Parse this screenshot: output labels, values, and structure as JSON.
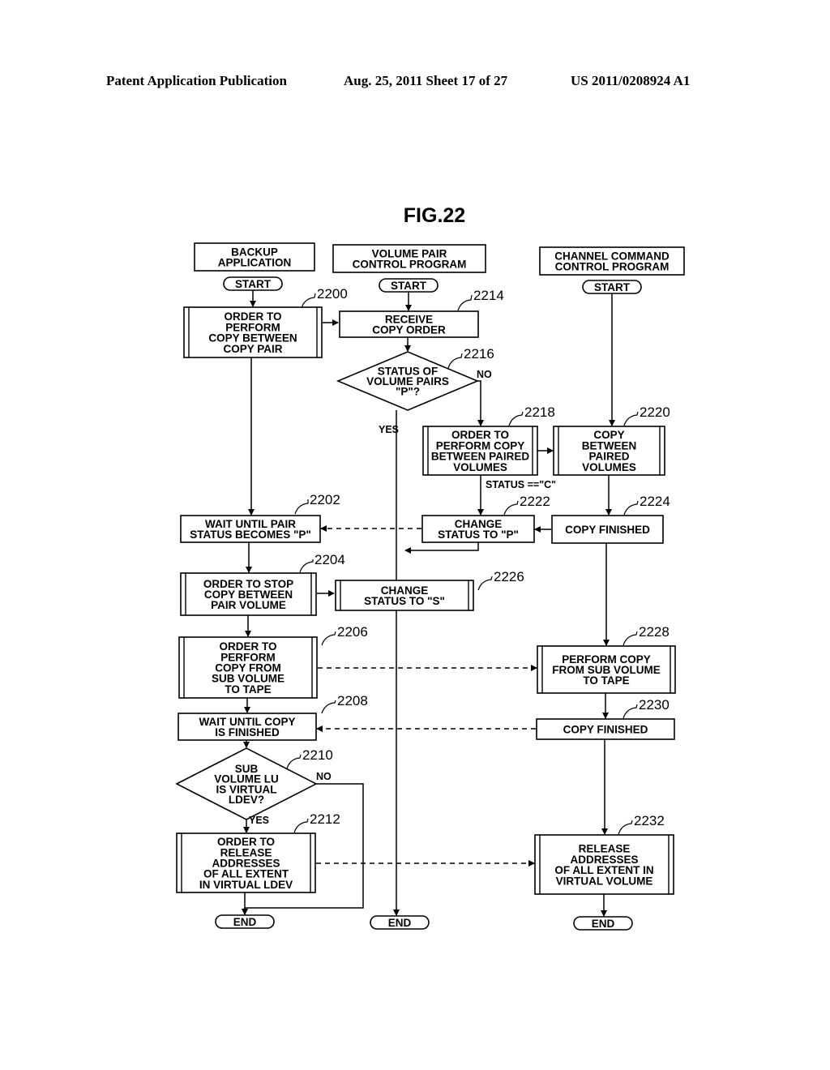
{
  "header": {
    "publication": "Patent Application Publication",
    "date_sheet": "Aug. 25, 2011  Sheet 17 of 27",
    "number": "US 2011/0208924 A1"
  },
  "figure": {
    "title": "FIG.22",
    "columns": [
      {
        "id": "backup",
        "title": [
          "BACKUP",
          "APPLICATION"
        ]
      },
      {
        "id": "vpcp",
        "title": [
          "VOLUME PAIR",
          "CONTROL PROGRAM"
        ]
      },
      {
        "id": "cccp",
        "title": [
          "CHANNEL COMMAND",
          "CONTROL PROGRAM"
        ]
      }
    ],
    "terminals": {
      "start": "START",
      "end": "END"
    },
    "steps": [
      {
        "ref": "2200",
        "type": "subroutine",
        "lines": [
          "ORDER TO",
          "PERFORM",
          "COPY BETWEEN",
          "COPY PAIR"
        ]
      },
      {
        "ref": "2214",
        "type": "process",
        "lines": [
          "RECEIVE",
          "COPY ORDER"
        ]
      },
      {
        "ref": "2216",
        "type": "decision",
        "lines": [
          "STATUS OF",
          "VOLUME PAIRS",
          "\"P\"?"
        ],
        "yes": "YES",
        "no": "NO"
      },
      {
        "ref": "2218",
        "type": "subroutine",
        "lines": [
          "ORDER TO",
          "PERFORM COPY",
          "BETWEEN PAIRED",
          "VOLUMES"
        ]
      },
      {
        "ref": "2220",
        "type": "subroutine",
        "lines": [
          "COPY",
          "BETWEEN",
          "PAIRED",
          "VOLUMES"
        ]
      },
      {
        "ref": "2202",
        "type": "process",
        "lines": [
          "WAIT UNTIL PAIR",
          "STATUS BECOMES \"P\""
        ]
      },
      {
        "ref": "2222",
        "type": "process",
        "lines": [
          "CHANGE",
          "STATUS TO \"P\""
        ]
      },
      {
        "ref": "2224",
        "type": "process",
        "lines": [
          "COPY FINISHED"
        ]
      },
      {
        "ref": "2204",
        "type": "subroutine",
        "lines": [
          "ORDER TO STOP",
          "COPY BETWEEN",
          "PAIR VOLUME"
        ]
      },
      {
        "ref": "2226",
        "type": "subroutine",
        "lines": [
          "CHANGE",
          "STATUS TO \"S\""
        ]
      },
      {
        "ref": "2206",
        "type": "subroutine",
        "lines": [
          "ORDER TO",
          "PERFORM",
          "COPY FROM",
          "SUB VOLUME",
          "TO TAPE"
        ]
      },
      {
        "ref": "2228",
        "type": "subroutine",
        "lines": [
          "PERFORM COPY",
          "FROM SUB VOLUME",
          "TO TAPE"
        ]
      },
      {
        "ref": "2208",
        "type": "process",
        "lines": [
          "WAIT UNTIL COPY",
          "IS FINISHED"
        ]
      },
      {
        "ref": "2230",
        "type": "process",
        "lines": [
          "COPY FINISHED"
        ]
      },
      {
        "ref": "2210",
        "type": "decision",
        "lines": [
          "SUB",
          "VOLUME LU",
          "IS VIRTUAL",
          "LDEV?"
        ],
        "yes": "YES",
        "no": "NO"
      },
      {
        "ref": "2212",
        "type": "subroutine",
        "lines": [
          "ORDER TO",
          "RELEASE",
          "ADDRESSES",
          "OF ALL EXTENT",
          "IN VIRTUAL LDEV"
        ]
      },
      {
        "ref": "2232",
        "type": "subroutine",
        "lines": [
          "RELEASE",
          "ADDRESSES",
          "OF ALL EXTENT IN",
          "VIRTUAL VOLUME"
        ]
      }
    ],
    "annotations": {
      "status_c": "STATUS ==\"C\""
    }
  }
}
